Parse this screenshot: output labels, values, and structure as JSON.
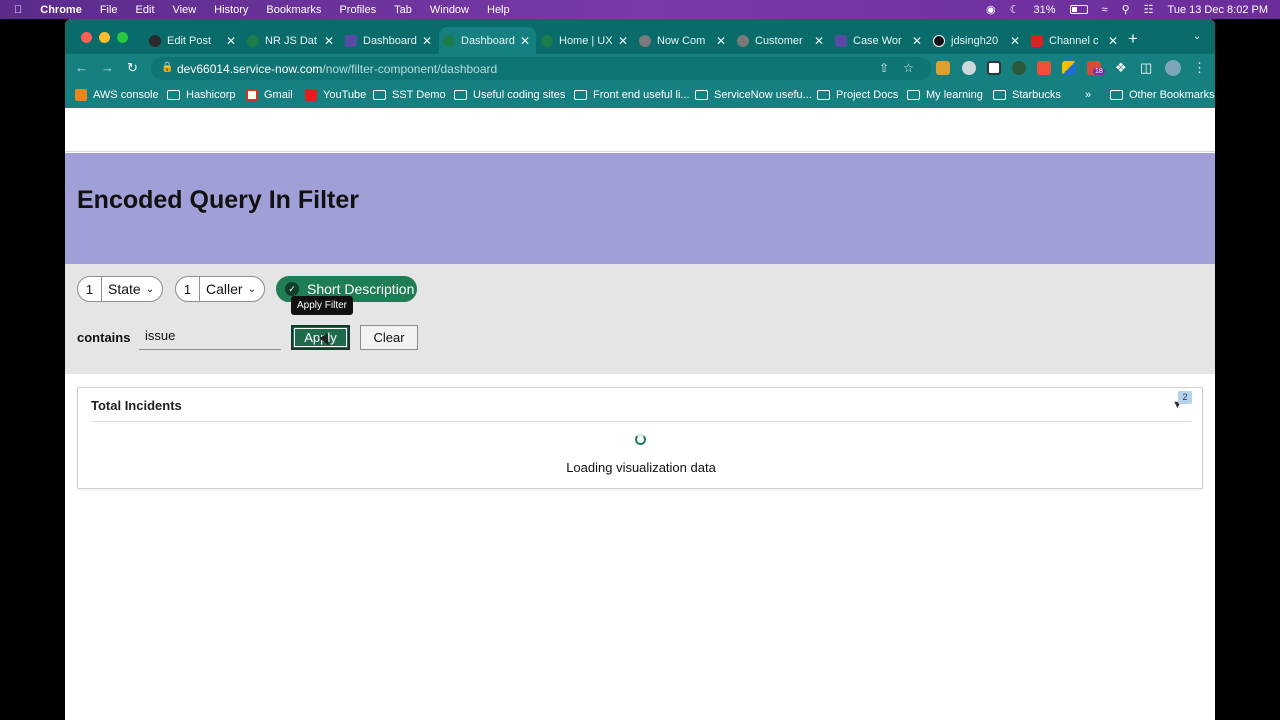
{
  "menubar": {
    "app": "Chrome",
    "items": [
      "File",
      "Edit",
      "View",
      "History",
      "Bookmarks",
      "Profiles",
      "Tab",
      "Window",
      "Help"
    ],
    "battery": "31%",
    "datetime": "Tue 13 Dec  8:02 PM"
  },
  "tabs": [
    {
      "title": "Edit Post",
      "color": "#2a2a2a"
    },
    {
      "title": "NR JS Dat",
      "color": "#1c7c4a"
    },
    {
      "title": "Dashboard",
      "color": "#5a4aa8"
    },
    {
      "title": "Dashboard",
      "color": "#1c7c4a"
    },
    {
      "title": "Home | UX",
      "color": "#1c7c4a"
    },
    {
      "title": "Now Com",
      "color": "#7a7a7a"
    },
    {
      "title": "Customer",
      "color": "#7a7a7a"
    },
    {
      "title": "Case Wor",
      "color": "#5a4aa8"
    },
    {
      "title": "jdsingh20",
      "color": "#111111"
    },
    {
      "title": "Channel c",
      "color": "#e02020"
    }
  ],
  "address": {
    "host": "dev66014.service-now.com",
    "path": "/now/filter-component/dashboard"
  },
  "bookmarks": [
    {
      "label": "AWS console",
      "icon": "aws-icon"
    },
    {
      "label": "Hashicorp",
      "icon": "folder-icon"
    },
    {
      "label": "Gmail",
      "icon": "gmail-icon"
    },
    {
      "label": "YouTube",
      "icon": "youtube-icon"
    },
    {
      "label": "SST Demo",
      "icon": "folder-icon"
    },
    {
      "label": "Useful coding sites",
      "icon": "folder-icon"
    },
    {
      "label": "Front end useful li...",
      "icon": "folder-icon"
    },
    {
      "label": "ServiceNow usefu...",
      "icon": "folder-icon"
    },
    {
      "label": "Project Docs",
      "icon": "folder-icon"
    },
    {
      "label": "My learning",
      "icon": "folder-icon"
    },
    {
      "label": "Starbucks",
      "icon": "folder-icon"
    }
  ],
  "bookmarks_more": "»",
  "other_bookmarks": "Other Bookmarks",
  "extension_badge": "18",
  "page": {
    "title": "Encoded Query In Filter",
    "filters": [
      {
        "count": "1",
        "label": "State"
      },
      {
        "count": "1",
        "label": "Caller"
      },
      {
        "label": "Short Description"
      }
    ],
    "tooltip": "Apply Filter",
    "contains_label": "contains",
    "input_value": "issue",
    "apply_label": "Apply",
    "clear_label": "Clear",
    "card": {
      "title": "Total Incidents",
      "filter_count": "2",
      "loading_text": "Loading visualization data"
    }
  },
  "colors": {
    "hero": "#a09fd7",
    "accent": "#1e7d54",
    "chrome_frame": "#167f7f"
  }
}
